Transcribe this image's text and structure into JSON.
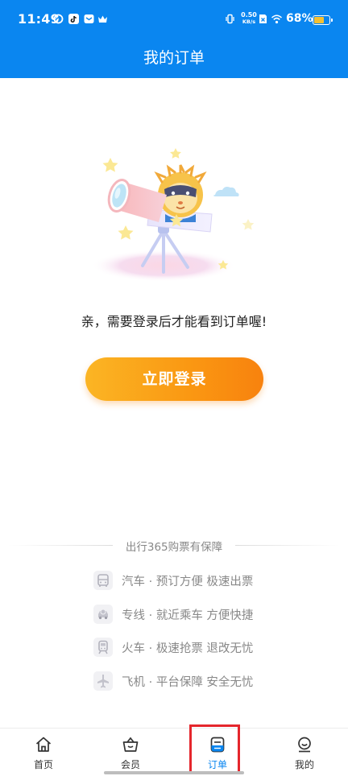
{
  "status_bar": {
    "time": "11:49",
    "net_speed_value": "0.50",
    "net_speed_unit": "KB/s",
    "battery_percent": "68%",
    "battery_level": 0.68,
    "icons": [
      "notification-swirl-icon",
      "tiktok-icon",
      "message-icon",
      "crown-icon",
      "vibrate-icon",
      "sim-x-icon",
      "wifi-icon",
      "battery-icon"
    ]
  },
  "header": {
    "title": "我的订单"
  },
  "empty_state": {
    "illustration": "mascot-telescope-illustration",
    "prompt": "亲，需要登录后才能看到订单喔!",
    "login_button": "立即登录"
  },
  "guarantee": {
    "title": "出行365购票有保障",
    "items": [
      {
        "icon": "bus-icon",
        "text": "汽车 · 预订方便  极速出票"
      },
      {
        "icon": "shuttle-car-icon",
        "text": "专线 · 就近乘车  方便快捷"
      },
      {
        "icon": "train-icon",
        "text": "火车 · 极速抢票  退改无忧"
      },
      {
        "icon": "airplane-icon",
        "text": "飞机 · 平台保障  安全无忧"
      }
    ]
  },
  "tabbar": {
    "tabs": [
      {
        "label": "首页",
        "icon": "home-icon"
      },
      {
        "label": "会员",
        "icon": "member-basket-icon"
      },
      {
        "label": "订单",
        "icon": "order-icon",
        "active": true
      },
      {
        "label": "我的",
        "icon": "profile-icon"
      }
    ]
  },
  "colors": {
    "brand_blue": "#0a86f0",
    "button_orange_start": "#fbb524",
    "button_orange_end": "#f8820e",
    "highlight_red": "#e5262c"
  }
}
